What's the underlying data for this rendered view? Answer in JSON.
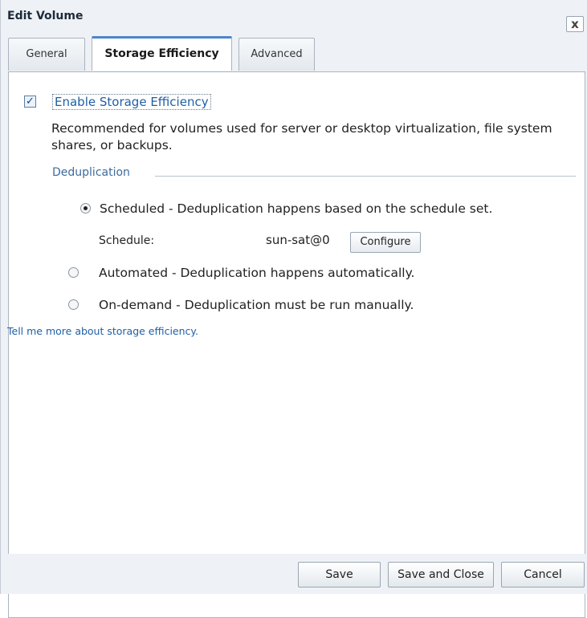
{
  "dialog": {
    "title": "Edit Volume",
    "close_label": "x"
  },
  "tabs": [
    {
      "label": "General"
    },
    {
      "label": "Storage Efficiency",
      "active": true
    },
    {
      "label": "Advanced"
    }
  ],
  "efficiency": {
    "enable_label": "Enable Storage Efficiency",
    "enabled": true,
    "description": "Recommended for volumes used for server or desktop virtualization, file system shares, or backups."
  },
  "dedup": {
    "section_title": "Deduplication",
    "options": [
      {
        "label": "Scheduled - Deduplication happens based on the schedule set.",
        "selected": true
      },
      {
        "label": "Automated - Deduplication happens automatically.",
        "selected": false
      },
      {
        "label": "On-demand - Deduplication must be run manually.",
        "selected": false
      }
    ],
    "schedule_label": "Schedule:",
    "schedule_value": "sun-sat@0",
    "configure_label": "Configure"
  },
  "help_link": "Tell me more about storage efficiency.",
  "footer": {
    "save_label": "Save",
    "save_close_label": "Save and Close",
    "cancel_label": "Cancel"
  },
  "icons": {
    "checkbox": "check-icon",
    "close": "close-icon"
  }
}
